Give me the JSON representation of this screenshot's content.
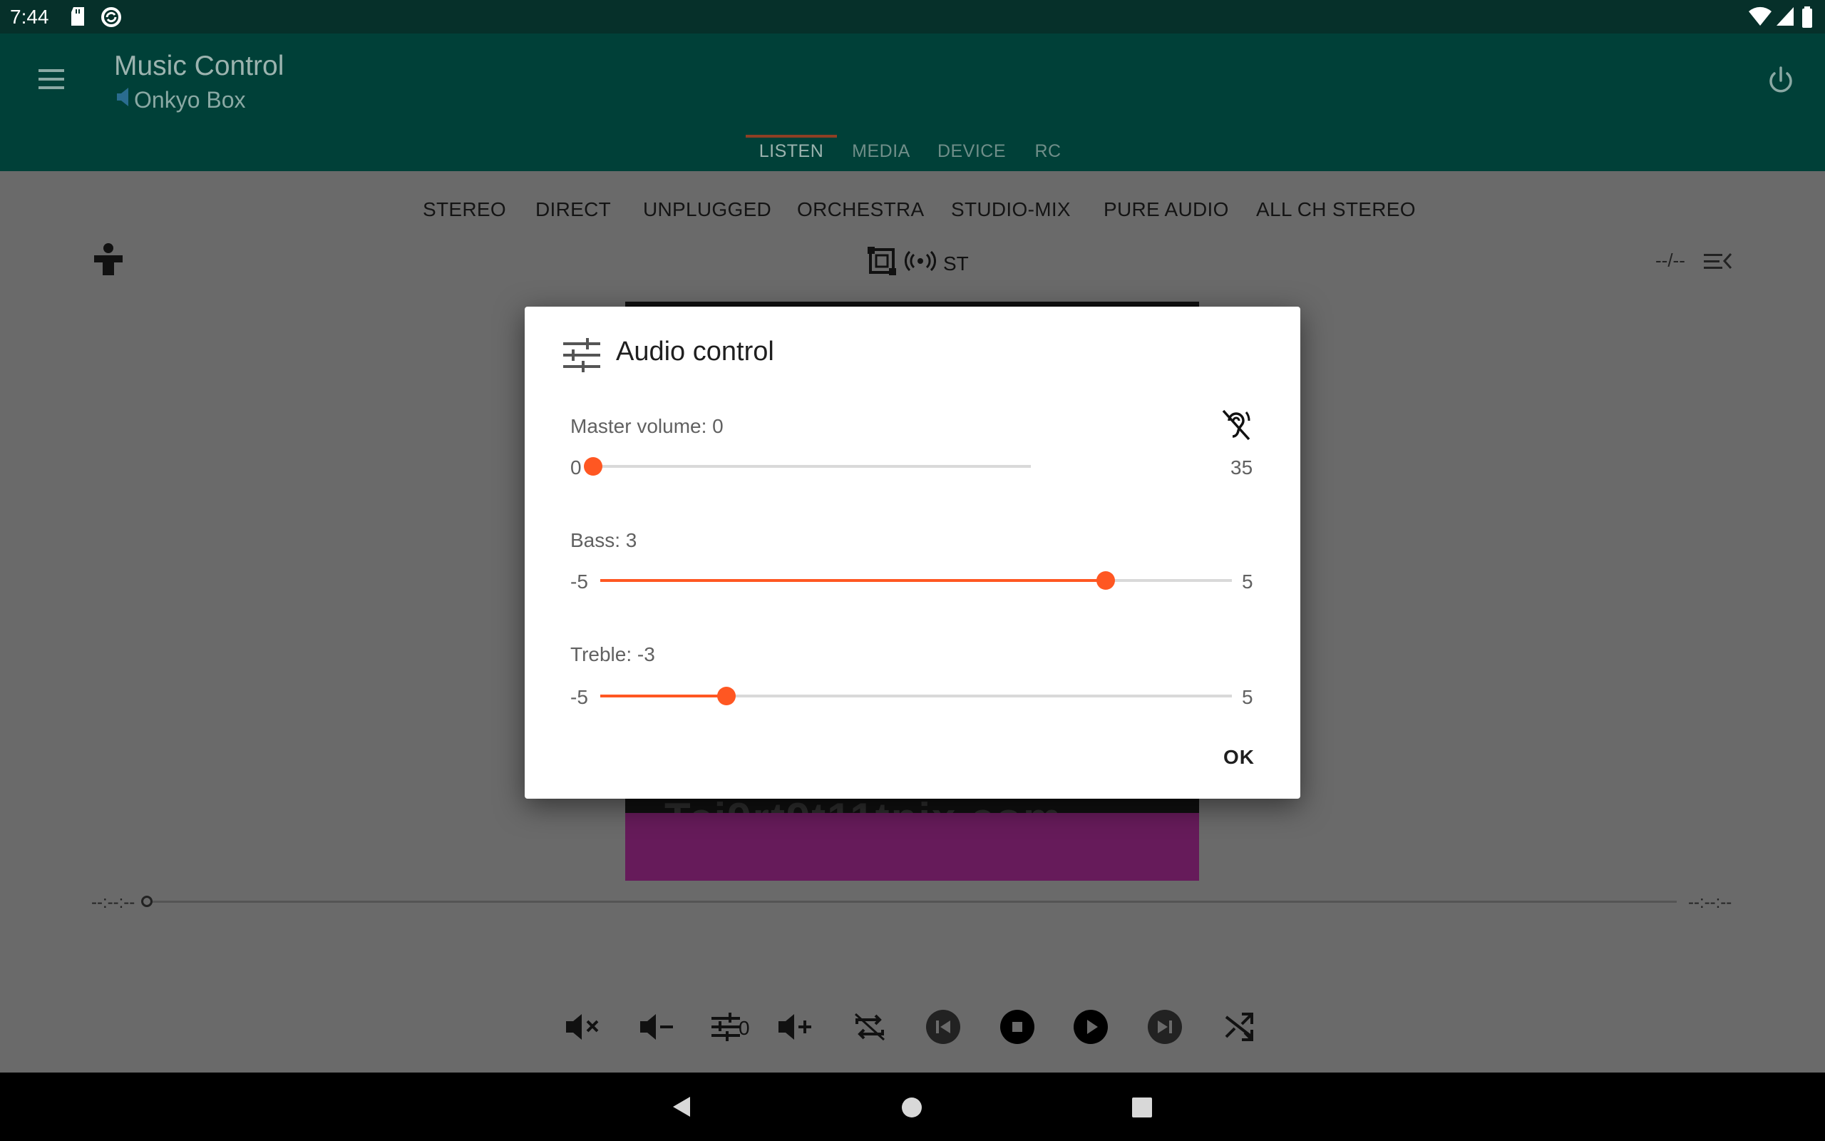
{
  "status_bar": {
    "time": "7:44"
  },
  "app_bar": {
    "title": "Music Control",
    "subtitle": "Onkyo Box",
    "tabs": [
      {
        "label": "LISTEN",
        "active": true
      },
      {
        "label": "MEDIA",
        "active": false
      },
      {
        "label": "DEVICE",
        "active": false
      },
      {
        "label": "RC",
        "active": false
      }
    ]
  },
  "listen": {
    "modes": [
      "STEREO",
      "DIRECT",
      "UNPLUGGED",
      "ORCHESTRA",
      "STUDIO-MIX",
      "PURE AUDIO",
      "ALL CH STEREO"
    ],
    "signal_label": "ST",
    "track_count": "--/--",
    "album_art_text": "Tci9rt9t11tnix.com",
    "seek": {
      "elapsed": "--:--:--",
      "total": "--:--:--",
      "progress": 0
    },
    "eq_value": "0"
  },
  "dialog": {
    "title": "Audio control",
    "master_volume": {
      "label": "Master volume: 0",
      "min": "0",
      "max": "35",
      "value": 0,
      "range": [
        0,
        35
      ]
    },
    "bass": {
      "label": "Bass: 3",
      "min": "-5",
      "max": "5",
      "value": 3,
      "range": [
        -5,
        5
      ]
    },
    "treble": {
      "label": "Treble: -3",
      "min": "-5",
      "max": "5",
      "value": -3,
      "range": [
        -5,
        5
      ]
    },
    "ok_label": "OK"
  },
  "colors": {
    "accent": "#ff5722",
    "primary_dark": "#004038",
    "status_bar": "#06302a"
  }
}
